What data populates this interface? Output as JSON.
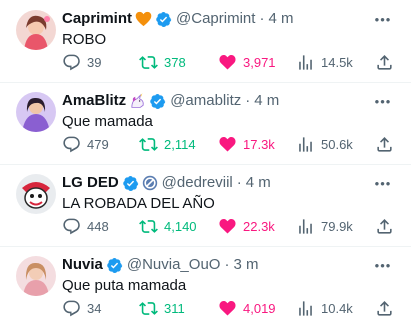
{
  "colors": {
    "text": "#0f1419",
    "muted": "#536471",
    "verified": "#1d9bf0",
    "retweeted": "#00ba7c",
    "liked": "#f91880",
    "divider": "#eff3f4"
  },
  "tweets": [
    {
      "name": "Caprimint",
      "badge_icon": "orange-heart-icon",
      "verified": true,
      "handle": "@Caprimint",
      "sep": "·",
      "time": "4 m",
      "text": "ROBO",
      "replies": "39",
      "retweets": "378",
      "likes": "3,971",
      "views": "14.5k",
      "retweeted": true,
      "liked": true
    },
    {
      "name": "AmaBlitz",
      "badge_icon": "unicorn-icon",
      "verified": true,
      "handle": "@amablitz",
      "sep": "·",
      "time": "4 m",
      "text": "Que mamada",
      "replies": "479",
      "retweets": "2,114",
      "likes": "17.3k",
      "views": "50.6k",
      "retweeted": true,
      "liked": true
    },
    {
      "name": "LG DED",
      "badge_icon": "circle-slash-icon",
      "verified": true,
      "handle": "@dedreviil",
      "sep": "·",
      "time": "4 m",
      "text": "LA ROBADA DEL AÑO",
      "replies": "448",
      "retweets": "4,140",
      "likes": "22.3k",
      "views": "79.9k",
      "retweeted": true,
      "liked": true
    },
    {
      "name": "Nuvia",
      "badge_icon": "",
      "verified": true,
      "handle": "@Nuvia_OuO",
      "sep": "·",
      "time": "3 m",
      "text": "Que puta mamada",
      "replies": "34",
      "retweets": "311",
      "likes": "4,019",
      "views": "10.4k",
      "retweeted": true,
      "liked": true
    }
  ]
}
